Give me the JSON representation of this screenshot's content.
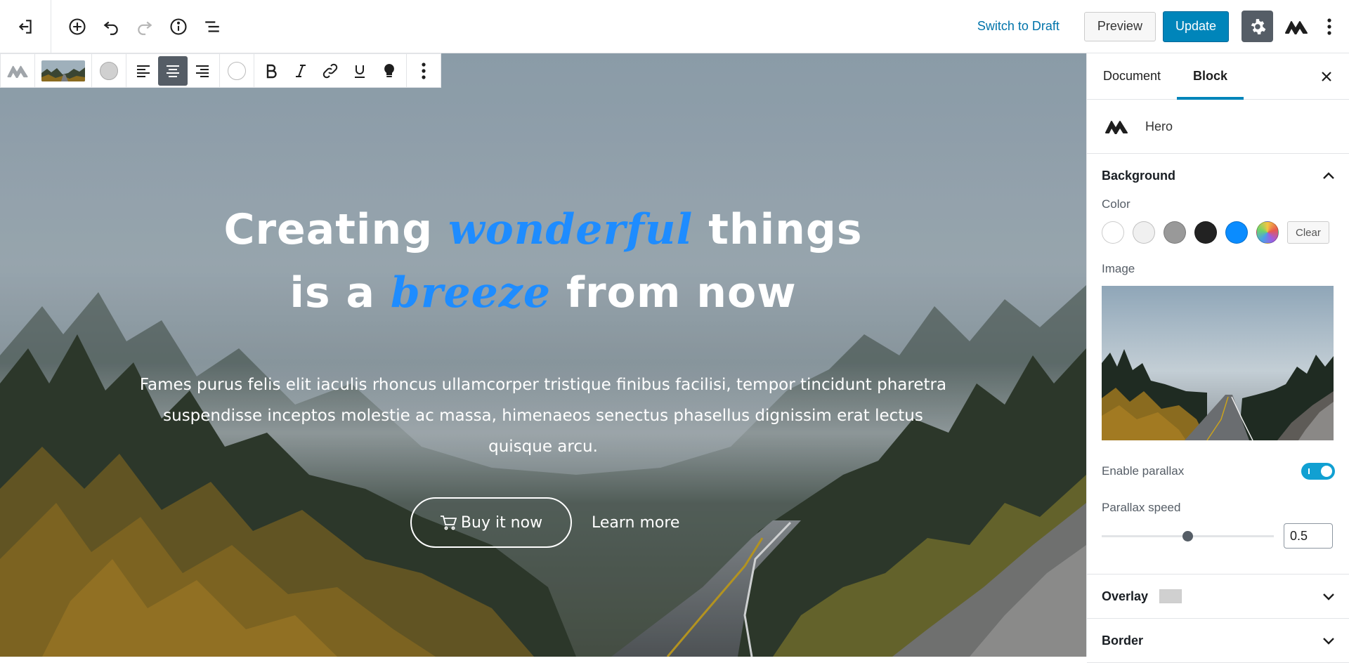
{
  "header": {
    "switch_to_draft": "Switch to Draft",
    "preview": "Preview",
    "update": "Update"
  },
  "hero": {
    "headline_line1_pre": "Creating ",
    "headline_line1_accent": "wonderful",
    "headline_line1_post": " things",
    "headline_line2_pre": "is a ",
    "headline_line2_accent": "breeze",
    "headline_line2_post": " from now",
    "lead_line1": "Fames purus felis elit iaculis rhoncus ullamcorper tristique finibus facilisi, tempor tincidunt pharetra",
    "lead_line2": "suspendisse inceptos molestie ac massa, himenaeos senectus phasellus dignissim erat lectus",
    "lead_line3": "quisque arcu.",
    "buy_button": "Buy it now",
    "learn_button": "Learn more",
    "accent_color": "#1e8cff"
  },
  "sidebar": {
    "tabs": [
      "Document",
      "Block"
    ],
    "active_tab": "Block",
    "block_name": "Hero",
    "background": {
      "title": "Background",
      "color_label": "Color",
      "colors": [
        "#ffffff",
        "#f0f0f0",
        "#999999",
        "#222222",
        "#0a8cff",
        "gradient"
      ],
      "clear_label": "Clear",
      "image_label": "Image",
      "parallax_label": "Enable parallax",
      "parallax_enabled": true,
      "speed_label": "Parallax speed",
      "speed_value": "0.5"
    },
    "overlay": {
      "title": "Overlay"
    },
    "border": {
      "title": "Border"
    }
  },
  "colors": {
    "primary": "#0085ba",
    "link": "#0073aa"
  }
}
